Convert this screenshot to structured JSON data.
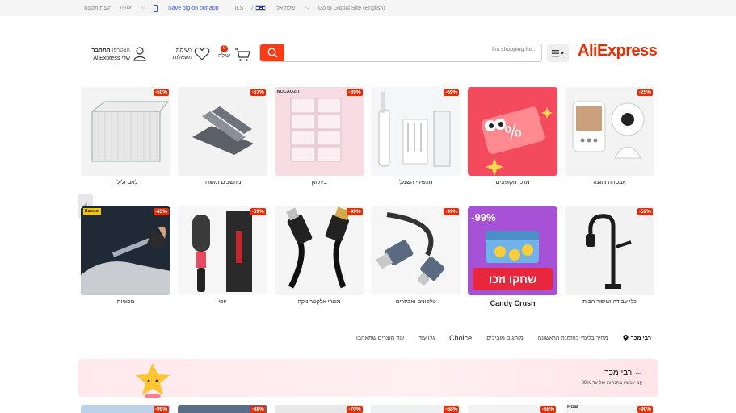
{
  "topbar": {
    "items": [
      "הגנת הקונה",
      "עזרה",
      "Save big on our app",
      "ILS",
      "שלח אל",
      "Go to Global Site (English)"
    ]
  },
  "header": {
    "logo": "AliExpress",
    "search_placeholder": "I'm shopping for...",
    "cart_label": "עגלה",
    "cart_count": "0",
    "wishlist_label_1": "רשימת",
    "wishlist_label_2": "משאלות",
    "account_line1_bold": "התחבר",
    "account_line1": "הצטרפו",
    "account_line2": "AliExpress שלי"
  },
  "categories_row1": [
    {
      "label": "אבטחה והגנה",
      "discount": "-25%"
    },
    {
      "label": "מרכז הקופונים",
      "discount": ""
    },
    {
      "label": "מכשירי חשמל",
      "discount": "-69%"
    },
    {
      "label": "בית וגן",
      "discount": "-39%"
    },
    {
      "label": "מחשבים ומשרד",
      "discount": "-63%"
    },
    {
      "label": "לאם ולילד",
      "discount": "-50%"
    }
  ],
  "categories_row2": [
    {
      "label": "כלי עבודה ושיפור הבית",
      "discount": "-52%"
    },
    {
      "label": "Candy Crush",
      "discount": "-99%"
    },
    {
      "label": "טלפונים ואביזרים",
      "discount": "-99%"
    },
    {
      "label": "מוצרי אלקטרוניקה",
      "discount": "-99%"
    },
    {
      "label": "יופי",
      "discount": "-69%"
    },
    {
      "label": "מכוניות",
      "discount": "-43%"
    }
  ],
  "tile_texts": {
    "candy_banner": "שחקו וזכו",
    "candy_pct": "-99%",
    "nocaozit": "NOCAOZIT",
    "baseus": "Baseus"
  },
  "tabs": [
    "רבי מכר",
    "מחיר בלעדי להזמנה הראשונה",
    "מותגים מובילים",
    "Choice",
    "גלו עוד",
    "עוד מוצרים שתאהבו"
  ],
  "banner": {
    "title": "רבי מכר",
    "subtitle": "קנו עכשיו בהנחות של עד 80%"
  },
  "bottom_discounts": [
    "-99%",
    "-88%",
    "-68%",
    "-70%",
    "-68%",
    "-90%"
  ],
  "bottom_rgb": "RGB",
  "colors": {
    "accent": "#e62e04",
    "search": "#fd3b14"
  }
}
